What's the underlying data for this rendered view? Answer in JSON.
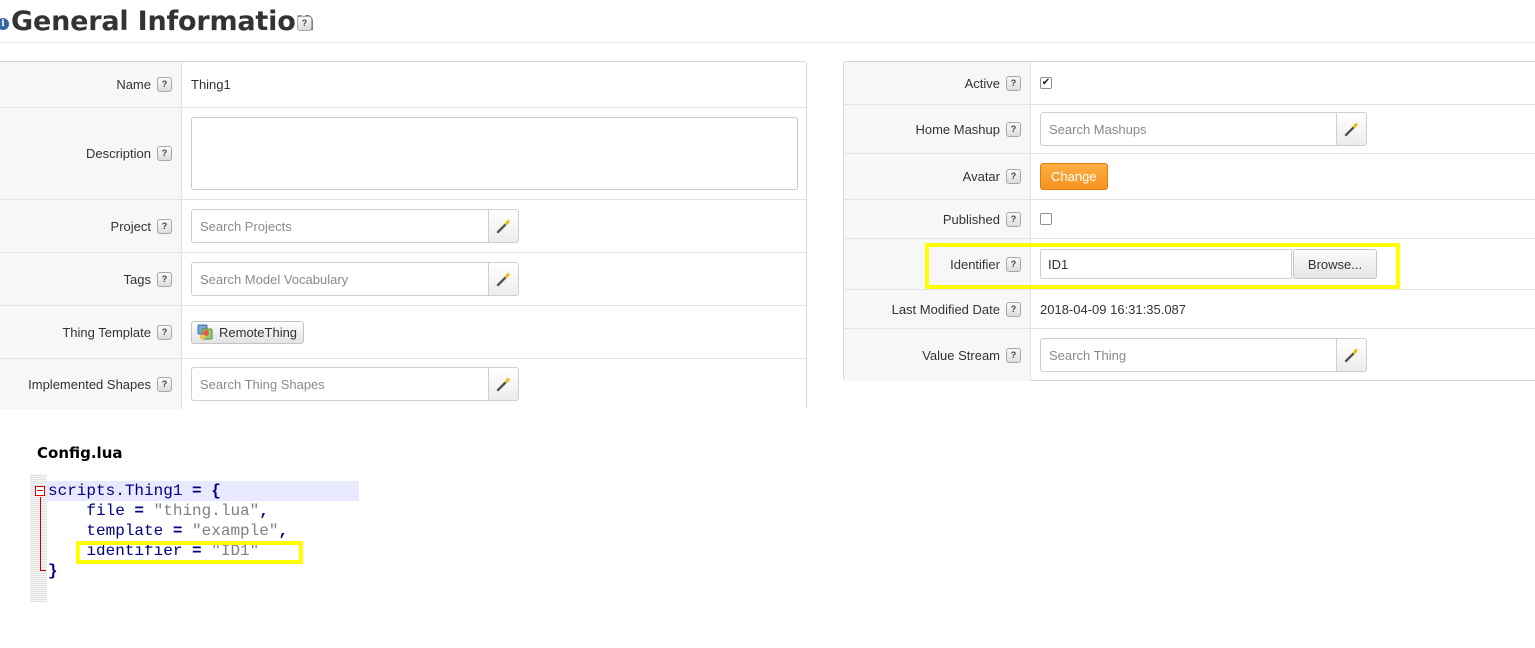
{
  "header": {
    "info_icon": "i",
    "title": "General Information",
    "help": "?"
  },
  "left_panel": {
    "rows": [
      {
        "label": "Name",
        "value": "Thing1"
      },
      {
        "label": "Description",
        "value": ""
      },
      {
        "label": "Project",
        "placeholder": "Search Projects"
      },
      {
        "label": "Tags",
        "placeholder": "Search Model Vocabulary"
      },
      {
        "label": "Thing Template",
        "value": "RemoteThing"
      },
      {
        "label": "Implemented Shapes",
        "placeholder": "Search Thing Shapes"
      }
    ]
  },
  "right_panel": {
    "rows": [
      {
        "label": "Active",
        "checked": true,
        "check_glyph": "✔"
      },
      {
        "label": "Home Mashup",
        "placeholder": "Search Mashups"
      },
      {
        "label": "Avatar",
        "button": "Change"
      },
      {
        "label": "Published",
        "checked": false
      },
      {
        "label": "Identifier",
        "value": "ID1",
        "button": "Browse..."
      },
      {
        "label": "Last Modified Date",
        "value": "2018-04-09 16:31:35.087"
      },
      {
        "label": "Value Stream",
        "placeholder": "Search Thing"
      }
    ]
  },
  "code": {
    "title": "Config.lua",
    "lines": [
      {
        "a": "scripts.Thing1",
        "op": "=",
        "b": "{"
      },
      {
        "a": "    file",
        "op": "=",
        "s": "\"thing.lua\"",
        "c": ","
      },
      {
        "a": "    template",
        "op": "=",
        "s": "\"example\"",
        "c": ","
      },
      {
        "a": "    identifier",
        "op": "=",
        "s": "\"ID1\""
      },
      {
        "a": "}"
      }
    ]
  },
  "icons": {
    "help": "help-icon",
    "wand": "magic-wand-icon",
    "template": "thing-template-icon",
    "info": "info-icon",
    "fold": "fold-collapse-icon"
  },
  "colors": {
    "highlight": "#ffff00",
    "accent_orange": "#f7a133",
    "panel_label_bg": "#f7f7f7",
    "lua_keyword": "#000080",
    "lua_string": "#808080",
    "fold_marker": "#cc0000"
  }
}
